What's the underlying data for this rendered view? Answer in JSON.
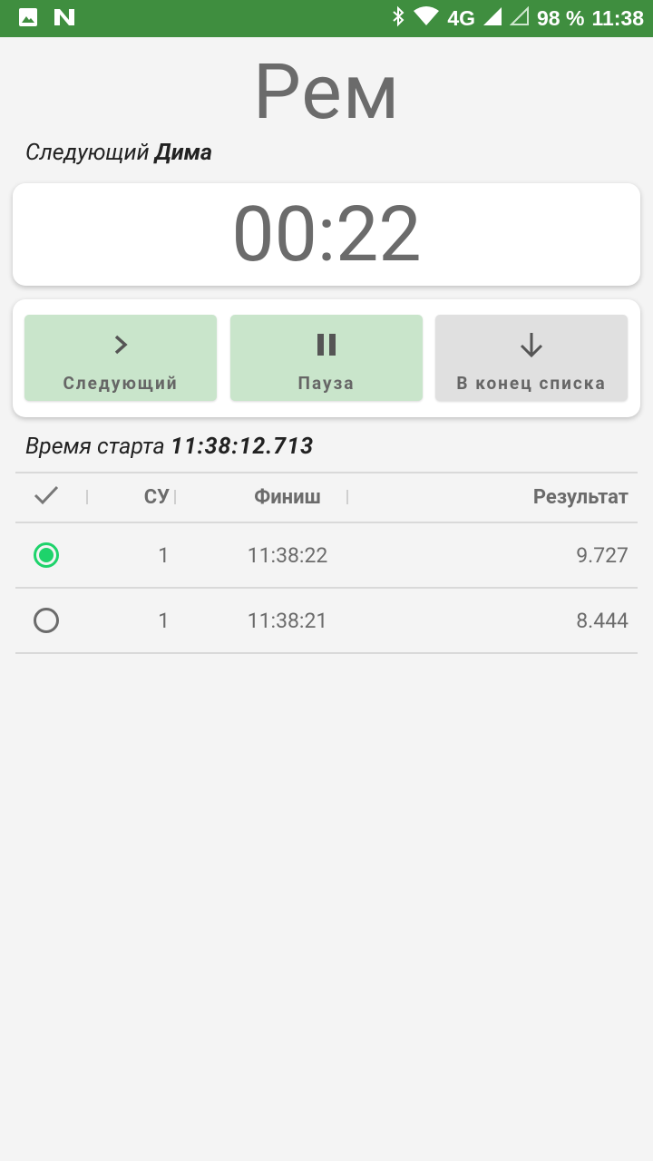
{
  "status_bar": {
    "network": "4G",
    "battery": "98 %",
    "time": "11:38",
    "icons": [
      "image-icon",
      "n-icon",
      "bluetooth-icon",
      "wifi-icon",
      "signal-icon",
      "signal-empty-icon"
    ]
  },
  "header": {
    "title": "Рем",
    "next_prefix": "Следующий",
    "next_name": "Дима"
  },
  "timer": {
    "value": "00:22"
  },
  "controls": {
    "next_label": "Следующий",
    "pause_label": "Пауза",
    "end_label": "В конец списка",
    "next_icon": "chevron-right-icon",
    "pause_icon": "pause-icon",
    "end_icon": "arrow-down-icon",
    "active_color": "#c9e5cb",
    "inactive_color": "#e0e0e0"
  },
  "start": {
    "prefix": "Время старта",
    "time": "11:38:12.713"
  },
  "table": {
    "columns": {
      "check": "check-icon",
      "su": "СУ",
      "finish": "Финиш",
      "result": "Результат"
    },
    "rows": [
      {
        "selected": true,
        "su": "1",
        "finish": "11:38:22",
        "result": "9.727"
      },
      {
        "selected": false,
        "su": "1",
        "finish": "11:38:21",
        "result": "8.444"
      }
    ],
    "selected_color": "#1ed36b"
  },
  "colors": {
    "statusbar": "#3f8e3f",
    "background": "#f4f4f4"
  }
}
